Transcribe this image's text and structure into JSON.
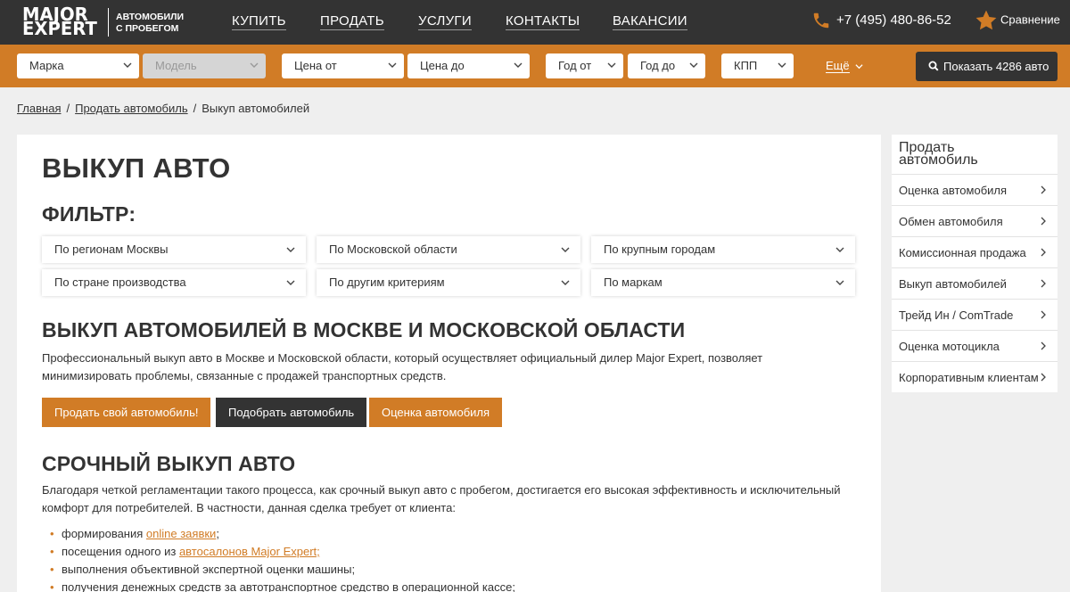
{
  "header": {
    "logo_line1": "MAJOR",
    "logo_line2": "EXPERT",
    "logo_sub1": "АВТОМОБИЛИ",
    "logo_sub2": "С ПРОБЕГОМ",
    "nav": [
      "КУПИТЬ",
      "ПРОДАТЬ",
      "УСЛУГИ",
      "КОНТАКТЫ",
      "ВАКАНСИИ"
    ],
    "phone": "+7 (495) 480-86-52",
    "compare": "Сравнение",
    "accent": "#d17c26"
  },
  "filters": {
    "brand": "Марка",
    "model": "Модель",
    "price_from": "Цена от",
    "price_to": "Цена до",
    "year_from": "Год от",
    "year_to": "Год до",
    "gearbox": "КПП",
    "more": "Ещё",
    "show_button": "Показать 4286 авто"
  },
  "breadcrumb": {
    "home": "Главная",
    "sell": "Продать автомобиль",
    "current": "Выкуп автомобилей"
  },
  "main": {
    "title": "ВЫКУП АВТО",
    "filter_heading": "ФИЛЬТР:",
    "dropdowns": [
      "По регионам Москвы",
      "По Московской области",
      "По крупным городам",
      "По стране производства",
      "По другим критериям",
      "По маркам"
    ],
    "section1_title": "ВЫКУП АВТОМОБИЛЕЙ В МОСКВЕ И МОСКОВСКОЙ ОБЛАСТИ",
    "section1_text": "Профессиональный выкуп авто в Москве и Московской области, который осуществляет официальный дилер Major Expert, позволяет минимизировать проблемы, связанные с продажей транспортных средств.",
    "btn_sell": "Продать свой автомобиль!",
    "btn_pick": "Подобрать автомобиль",
    "btn_eval": "Оценка автомобиля",
    "section2_title": "СРОЧНЫЙ ВЫКУП АВТО",
    "section2_text": "Благодаря четкой регламентации такого процесса, как срочный выкуп авто с пробегом, достигается его высокая эффективность и исключительный комфорт для потребителей. В частности, данная сделка требует от клиента:",
    "list": [
      {
        "before": "формирования ",
        "link": "online заявки",
        "after": ";"
      },
      {
        "before": "посещения одного из ",
        "link": "автосалонов Major Expert;",
        "after": ""
      },
      {
        "before": "выполнения объективной экспертной оценки машины;",
        "link": "",
        "after": ""
      },
      {
        "before": "получения денежных средств за автотранспортное средство в операционной кассе;",
        "link": "",
        "after": ""
      }
    ]
  },
  "sidebar": {
    "title": "Продать автомобиль",
    "items": [
      "Оценка автомобиля",
      "Обмен автомобиля",
      "Комиссионная продажа",
      "Выкуп автомобилей",
      "Трейд Ин / ComTrade",
      "Оценка мотоцикла",
      "Корпоративным клиентам"
    ]
  }
}
